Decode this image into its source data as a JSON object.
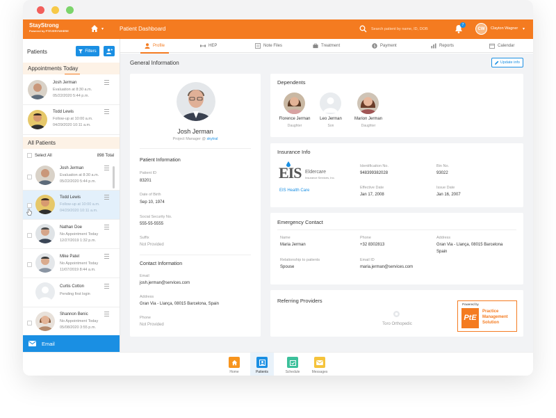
{
  "brand": {
    "name": "StayStrong",
    "tagline": "Powered by PTEVERYWHERE"
  },
  "header": {
    "page_title": "Patient Dashboard",
    "search_placeholder": "Search patient by name, ID, DOB",
    "notification_count": "7",
    "user_initials": "CW",
    "user_name": "Clayton Wagner"
  },
  "sidebar": {
    "title": "Patients",
    "filters_label": "Filters",
    "appointments_heading": "Appointments Today",
    "appointments": [
      {
        "name": "Josh Jerman",
        "line1": "Evaluation at 8:30 a.m.",
        "line2": "05/22/2020 5:44 p.m."
      },
      {
        "name": "Todd Lewis",
        "line1": "Follow-up at 10:00 a.m.",
        "line2": "04/29/2020 10:11 a.m."
      }
    ],
    "all_heading": "All Patients",
    "select_all": "Select All",
    "total": "898 Total",
    "patients": [
      {
        "name": "Josh Jerman",
        "line1": "Evaluation at 8:30 a.m.",
        "line2": "05/22/2020 5:44 p.m."
      },
      {
        "name": "Todd Lewis",
        "line1": "Follow-up at 10:00 a.m.",
        "line2": "04/29/2020 10:11 a.m."
      },
      {
        "name": "Nathan Doe",
        "line1": "No Appointment Today",
        "line2": "12/27/2019 1:32 p.m."
      },
      {
        "name": "Mike Patel",
        "line1": "No Appointment Today",
        "line2": "11/07/2019 8:44 a.m."
      },
      {
        "name": "Curtis Cotton",
        "line1": "Pending first login",
        "line2": ""
      },
      {
        "name": "Shannon Benic",
        "line1": "No Appointment Today",
        "line2": "05/08/2020 3:55 p.m."
      }
    ],
    "email_label": "Email"
  },
  "tabs": [
    "Profile",
    "HEP",
    "Note Files",
    "Treatment",
    "Payment",
    "Reports",
    "Calendar"
  ],
  "main": {
    "section_title": "General Information",
    "update_label": "Update info",
    "profile": {
      "name": "Josh Jerman",
      "role": "Project Manager @",
      "company": "skytral",
      "patient_info_title": "Patient Information",
      "patient_id_label": "Patient ID",
      "patient_id": "83201",
      "dob_label": "Date of Birth",
      "dob": "Sep 10, 1974",
      "ssn_label": "Social Security No.",
      "ssn": "555-55-5555",
      "suffix_label": "Suffix",
      "suffix": "Not Provided",
      "contact_title": "Contact Information",
      "email_label": "Email",
      "email": "josh.jerman@services.com",
      "address_label": "Address",
      "address": "Gran Via - Llança, 08015 Barcelona, Spain",
      "phone_label": "Phone",
      "phone": "Not Provided"
    },
    "dependents": {
      "title": "Dependents",
      "items": [
        {
          "name": "Florence Jerman",
          "relation": "Daughter"
        },
        {
          "name": "Leo Jerman",
          "relation": "Son"
        },
        {
          "name": "Marion Jerman",
          "relation": "Daughter"
        }
      ]
    },
    "insurance": {
      "title": "Insurance Info",
      "logo_text": "EIS",
      "logo_sub1": "Eldercare",
      "logo_sub2": "Insurance Services, Inc.",
      "company": "EIS Health Care",
      "id_label": "Identificaiton No.",
      "id": "948399382028",
      "bin_label": "Bin No.",
      "bin": "93022",
      "eff_label": "Effective Date",
      "eff": "Jan 17, 2008",
      "issue_label": "Issue Date",
      "issue": "Jan 16, 2007"
    },
    "emergency": {
      "title": "Emergency Contact",
      "name_label": "Name",
      "name": "Maria Jerman",
      "phone_label": "Phone",
      "phone": "+32 8302813",
      "address_label": "Address",
      "address1": "Gran Via - Llança, 08015 Barcelona",
      "address2": "Spain",
      "rel_label": "Relationship to patients",
      "rel": "Spouse",
      "email_label": "Email ID",
      "email": "maria.jerman@services.com"
    },
    "referring": {
      "title": "Referring Providers",
      "provider": "Toro Orthopedic",
      "badge_powered": "Powered by",
      "badge_logo": "PtE",
      "badge_line1": "Practice",
      "badge_line2": "Management",
      "badge_line3": "Solution"
    }
  },
  "bottom_nav": [
    "Home",
    "Patients",
    "Schedule",
    "Messages"
  ],
  "colors": {
    "brand": "#f47b20",
    "accent": "#1a8fe3"
  }
}
